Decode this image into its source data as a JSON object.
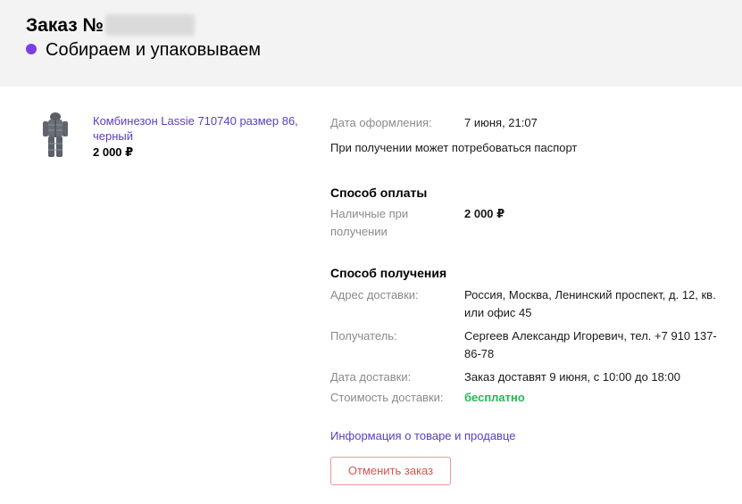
{
  "order": {
    "title": "Заказ №",
    "status": "Собираем и упаковываем",
    "status_color": "#7b3fe4"
  },
  "product": {
    "name": "Комбинезон Lassie 710740 размер 86, черный",
    "price": "2 000 ₽",
    "image_icon": "jumpsuit-thumbnail"
  },
  "details": {
    "order_date_label": "Дата оформления:",
    "order_date_value": "7 июня, 21:07",
    "passport_note": "При получении может потребоваться паспорт",
    "payment": {
      "title": "Способ оплаты",
      "method_label": "Наличные при получении",
      "amount": "2 000 ₽"
    },
    "delivery": {
      "title": "Способ получения",
      "address_label": "Адрес доставки:",
      "address_value": "Россия, Москва, Ленинский проспект, д. 12, кв. или офис 45",
      "recipient_label": "Получатель:",
      "recipient_value": "Сергеев Александр Игоревич, тел. +7 910 137-86-78",
      "date_label": "Дата доставки:",
      "date_value": "Заказ доставят 9 июня, с 10:00 до 18:00",
      "cost_label": "Стоимость доставки:",
      "cost_value": "бесплатно",
      "cost_color": "#2ab655"
    },
    "info_link": "Информация о товаре и продавце",
    "cancel_button": "Отменить заказ"
  }
}
